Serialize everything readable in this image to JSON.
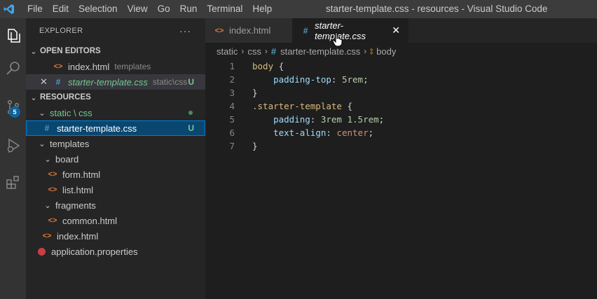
{
  "titlebar": {
    "menu": [
      "File",
      "Edit",
      "Selection",
      "View",
      "Go",
      "Run",
      "Terminal",
      "Help"
    ],
    "title": "starter-template.css - resources - Visual Studio Code"
  },
  "activity": {
    "scm_badge": "5"
  },
  "explorer": {
    "header": "EXPLORER",
    "more": "···",
    "open_editors": {
      "label": "OPEN EDITORS",
      "items": [
        {
          "name": "index.html",
          "desc": "templates"
        },
        {
          "name": "starter-template.css",
          "desc": "static\\css",
          "status": "U"
        }
      ]
    },
    "resources": {
      "label": "RESOURCES",
      "folder_static": "static \\ css",
      "starter_css": "starter-template.css",
      "starter_status": "U",
      "templates": "templates",
      "board": "board",
      "form_html": "form.html",
      "list_html": "list.html",
      "fragments": "fragments",
      "common_html": "common.html",
      "index_html": "index.html",
      "app_props": "application.properties"
    }
  },
  "tabs": [
    {
      "label": "index.html"
    },
    {
      "label": "starter-template.css"
    }
  ],
  "breadcrumb": {
    "static": "static",
    "css": "css",
    "file": "starter-template.css",
    "symbol": "body"
  },
  "code": {
    "lines": [
      {
        "n": "1",
        "sel": "body",
        "rest": " {"
      },
      {
        "n": "2",
        "prop": "padding-top",
        "val": "5rem"
      },
      {
        "n": "3",
        "punc": "}"
      },
      {
        "n": "4",
        "sel": ".starter-template",
        "rest": " {"
      },
      {
        "n": "5",
        "prop": "padding",
        "val": "3rem 1.5rem"
      },
      {
        "n": "6",
        "prop": "text-align",
        "val": "center"
      },
      {
        "n": "7",
        "punc": "}"
      }
    ]
  }
}
